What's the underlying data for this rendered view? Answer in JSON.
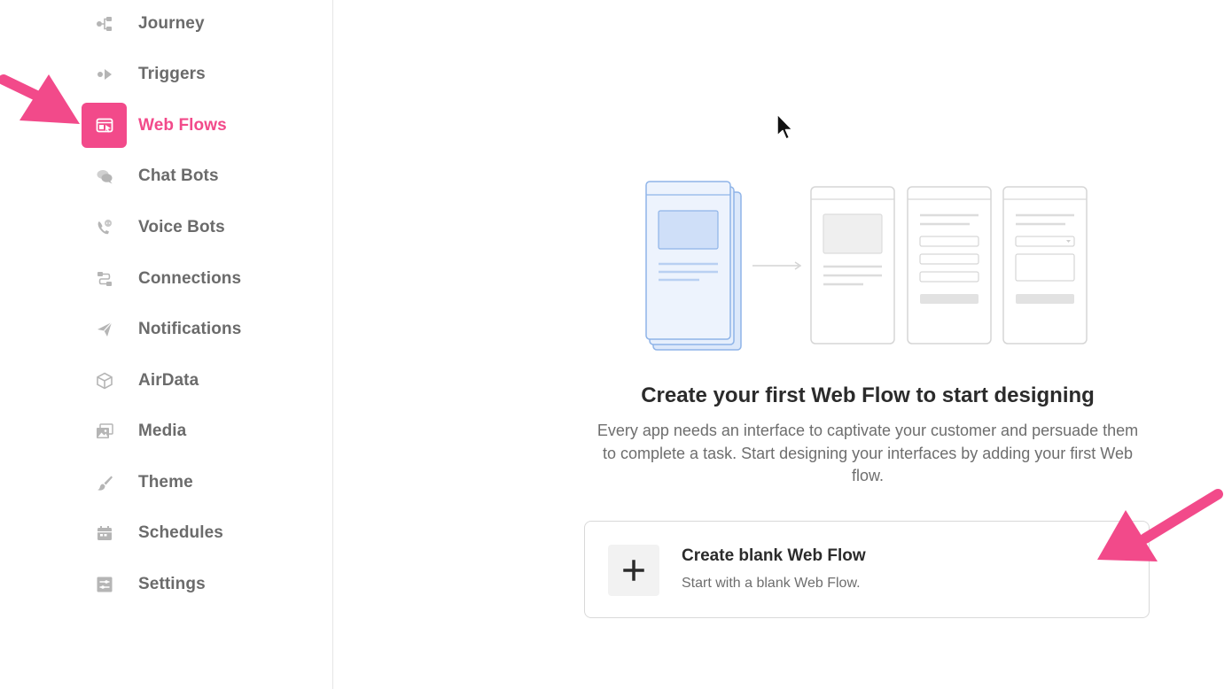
{
  "sidebar": {
    "items": [
      {
        "label": "Journey",
        "icon": "journey-icon"
      },
      {
        "label": "Triggers",
        "icon": "triggers-icon"
      },
      {
        "label": "Web Flows",
        "icon": "web-flows-icon",
        "active": true
      },
      {
        "label": "Chat Bots",
        "icon": "chat-bots-icon"
      },
      {
        "label": "Voice Bots",
        "icon": "voice-bots-icon"
      },
      {
        "label": "Connections",
        "icon": "connections-icon"
      },
      {
        "label": "Notifications",
        "icon": "notifications-icon"
      },
      {
        "label": "AirData",
        "icon": "airdata-icon"
      },
      {
        "label": "Media",
        "icon": "media-icon"
      },
      {
        "label": "Theme",
        "icon": "theme-icon"
      },
      {
        "label": "Schedules",
        "icon": "schedules-icon"
      },
      {
        "label": "Settings",
        "icon": "settings-icon"
      }
    ]
  },
  "empty_state": {
    "title": "Create your first Web Flow to start designing",
    "description": "Every app needs an interface to captivate your customer and persuade them to complete a task. Start designing your interfaces by adding your first Web flow."
  },
  "create_card": {
    "title": "Create blank Web Flow",
    "subtitle": "Start with a blank Web Flow.",
    "icon": "plus-icon"
  },
  "colors": {
    "accent": "#f24a8a",
    "nav_text": "#6b6b6b",
    "illustration_blue": "#8fb4e8"
  }
}
